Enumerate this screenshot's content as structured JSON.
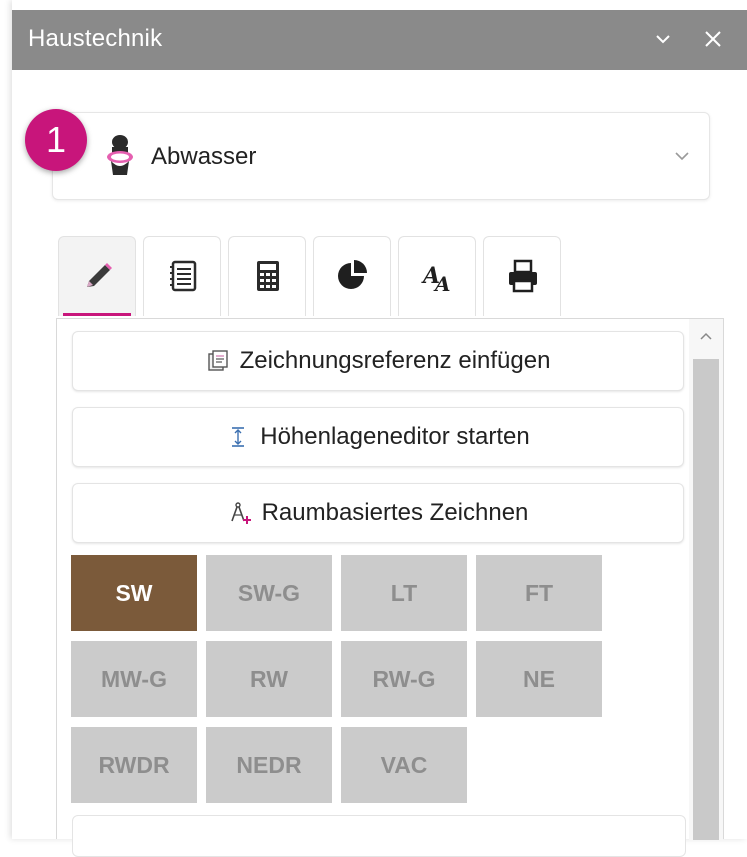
{
  "window": {
    "title": "Haustechnik",
    "bar_color": "#8a8a8a",
    "icons": [
      "chevron-down-icon",
      "close-icon"
    ]
  },
  "selector": {
    "badge_number": "1",
    "badge_color": "#c8157b",
    "icon": "toilet-icon",
    "value": "Abwasser"
  },
  "tabs": [
    {
      "icon": "pencil-icon",
      "active": true
    },
    {
      "icon": "notebook-icon",
      "active": false
    },
    {
      "icon": "calculator-icon",
      "active": false
    },
    {
      "icon": "pie-chart-icon",
      "active": false
    },
    {
      "icon": "text-style-icon",
      "active": false
    },
    {
      "icon": "printer-icon",
      "active": false
    }
  ],
  "actions": [
    {
      "icon": "drawing-reference-icon",
      "label": "Zeichnungsreferenz einfügen"
    },
    {
      "icon": "height-editor-icon",
      "label": "Höhenlageneditor starten"
    },
    {
      "icon": "room-drawing-icon",
      "label": "Raumbasiertes Zeichnen"
    }
  ],
  "systems": {
    "selected": "SW",
    "selected_color": "#7b5a3a",
    "rows": [
      [
        "SW",
        "SW-G",
        "LT",
        "FT"
      ],
      [
        "MW-G",
        "RW",
        "RW-G",
        "NE"
      ],
      [
        "RWDR",
        "NEDR",
        "VAC"
      ]
    ]
  }
}
